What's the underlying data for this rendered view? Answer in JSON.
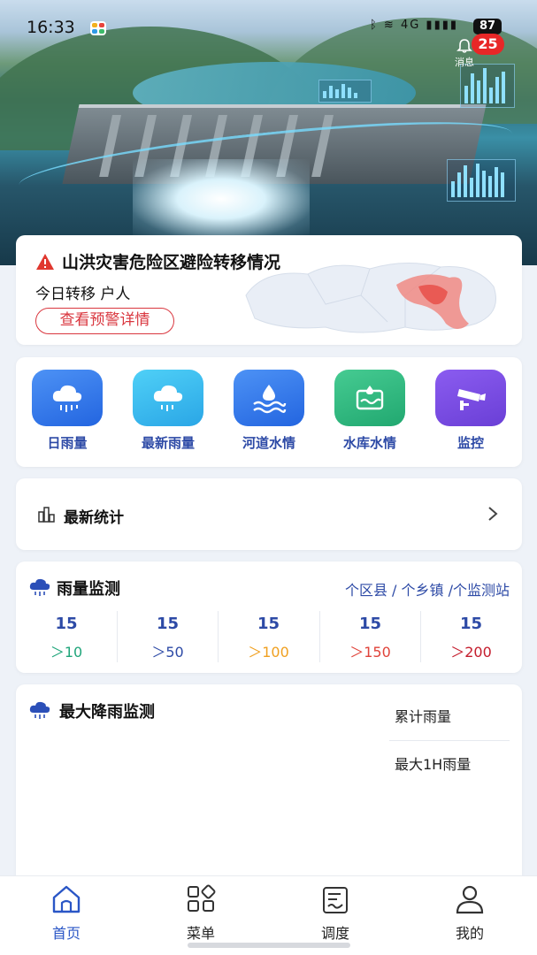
{
  "status_bar": {
    "time": "16:33",
    "signal_text": "ᛒ ≋ 4G ▮▮▮▮",
    "battery": "87"
  },
  "header": {
    "notification_label": "消息",
    "notification_count": "25"
  },
  "alert_card": {
    "title": "山洪灾害危险区避险转移情况",
    "subtitle": "今日转移 户人",
    "button_label": "查看预警详情"
  },
  "quick_actions": [
    {
      "label": "日雨量",
      "icon": "rain-cloud-icon",
      "color": "#2f74e8"
    },
    {
      "label": "最新雨量",
      "icon": "rain-cloud-icon",
      "color": "#36b8ee"
    },
    {
      "label": "河道水情",
      "icon": "water-wave-icon",
      "color": "#2f74e8"
    },
    {
      "label": "水库水情",
      "icon": "reservoir-icon",
      "color": "#2db883"
    },
    {
      "label": "监控",
      "icon": "camera-icon",
      "color": "#7b4ee0"
    }
  ],
  "stats": {
    "title": "最新统计"
  },
  "rain_monitor": {
    "title": "雨量监测",
    "summary": "个区县 / 个乡镇 /个监测站",
    "levels": [
      {
        "count": "15",
        "threshold": "＞10",
        "color": "#1fa57a"
      },
      {
        "count": "15",
        "threshold": "＞50",
        "color": "#2d4aa6"
      },
      {
        "count": "15",
        "threshold": "＞100",
        "color": "#f0a020"
      },
      {
        "count": "15",
        "threshold": "＞150",
        "color": "#e0433a"
      },
      {
        "count": "15",
        "threshold": "＞200",
        "color": "#c41c2c"
      }
    ]
  },
  "max_rain": {
    "title": "最大降雨监测",
    "tabs": [
      "累计雨量",
      "最大1H雨量"
    ]
  },
  "tab_bar": {
    "items": [
      {
        "label": "首页",
        "active": true
      },
      {
        "label": "菜单",
        "active": false
      },
      {
        "label": "调度",
        "active": false
      },
      {
        "label": "我的",
        "active": false
      }
    ]
  },
  "colors": {
    "accent": "#2a56c6",
    "alert_red": "#d9363e"
  }
}
